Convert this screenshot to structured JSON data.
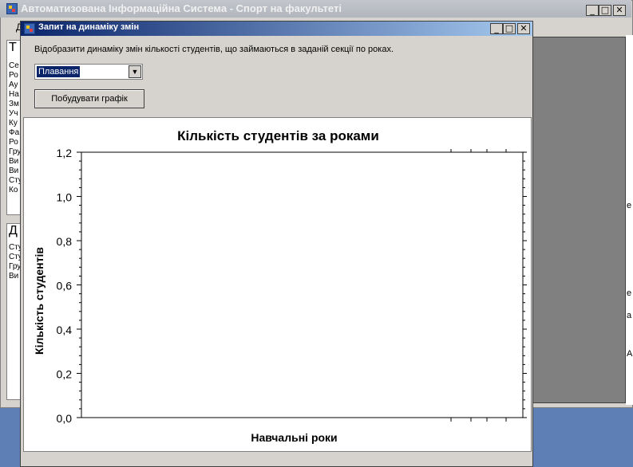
{
  "main_window": {
    "title": "Автоматизована Інформаційна Система - Спорт на факультеті",
    "menu_first_letter": "Д"
  },
  "left_panel": {
    "group1_letter": "Т",
    "group1_items": [
      "Се",
      "Ро",
      "Ау",
      "На",
      "Зм",
      "Уч",
      "Ку",
      "Фа",
      "Ро",
      "Гру",
      "Ви",
      "Ви",
      "Сту",
      "Ко"
    ],
    "group2_letter": "Д",
    "group2_items": [
      "Сту",
      "Сту",
      "Гру",
      "Ви"
    ]
  },
  "right_strip_glyphs": [
    "е",
    "е",
    "а",
    "А"
  ],
  "dialog": {
    "title": "Запит на динаміку змін",
    "caption": "Відобразити динаміку змін кількості студентів, що займаються в заданій секції по роках.",
    "section_select": {
      "value": "Плавання"
    },
    "build_button": "Побудувати графік"
  },
  "chart_data": {
    "type": "line",
    "title": "Кількість студентів за роками",
    "xlabel": "Навчальні роки",
    "ylabel": "Кількість  студентів",
    "ylim": [
      0,
      1.2
    ],
    "y_ticks": [
      "0,0",
      "0,2",
      "0,4",
      "0,6",
      "0,8",
      "1,0",
      "1,2"
    ],
    "series": []
  },
  "colors": {
    "dialog_title_start": "#0a246a",
    "dialog_title_end": "#a6caf0",
    "mdi_background": "#808080",
    "window_face": "#d6d3ce"
  }
}
